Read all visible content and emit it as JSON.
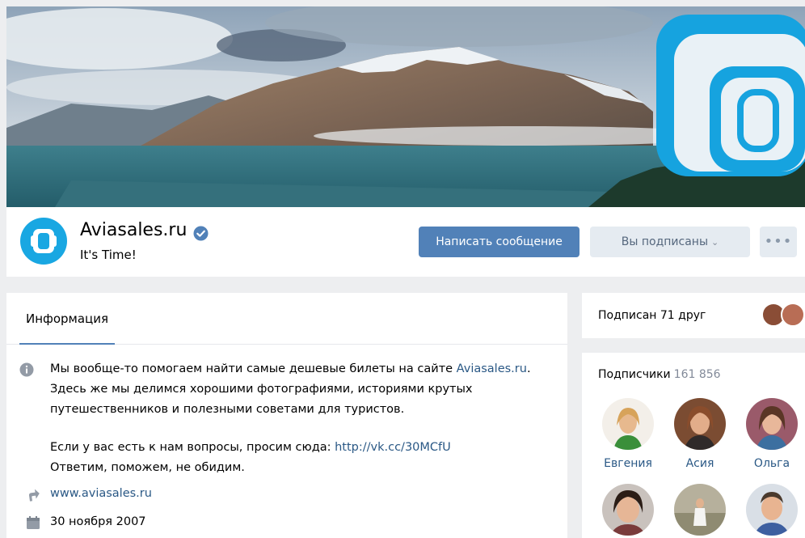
{
  "group": {
    "name": "Aviasales.ru",
    "status": "It's Time!",
    "verified": true,
    "brand_color": "#19a7e2"
  },
  "actions": {
    "message_label": "Написать сообщение",
    "subscribed_label": "Вы подписаны",
    "more_label": "•••"
  },
  "tabs": [
    {
      "label": "Информация",
      "active": true
    }
  ],
  "info": {
    "description": {
      "l1_text": "Мы вообще-то помогаем найти самые дешевые билеты на сайте ",
      "l1_link": "Aviasales.ru",
      "l1_end": ".",
      "l2": "Здесь же мы делимся хорошими фотографиями, историями крутых",
      "l3": "путешественников и полезными советами для туристов.",
      "l4_text": "Если у вас есть к нам вопросы, просим сюда: ",
      "l4_link": "http://vk.cc/30MCfU",
      "l5": "Ответим, поможем, не обидим."
    },
    "website": "www.aviasales.ru",
    "founded": "30 ноября 2007",
    "icons": [
      "info-icon",
      "link-arrow-icon",
      "calendar-icon"
    ]
  },
  "friends": {
    "label": "Подписан 71 друг"
  },
  "subscribers": {
    "title": "Подписчики",
    "count": "161 856",
    "members": [
      {
        "name": "Евгения"
      },
      {
        "name": "Асия"
      },
      {
        "name": "Ольга"
      },
      {
        "name": ""
      },
      {
        "name": ""
      },
      {
        "name": ""
      }
    ]
  },
  "colors": {
    "accent": "#5181b8",
    "link": "#2a5885",
    "secondary_button": "#e5ebf1",
    "page_bg": "#edeef0"
  }
}
